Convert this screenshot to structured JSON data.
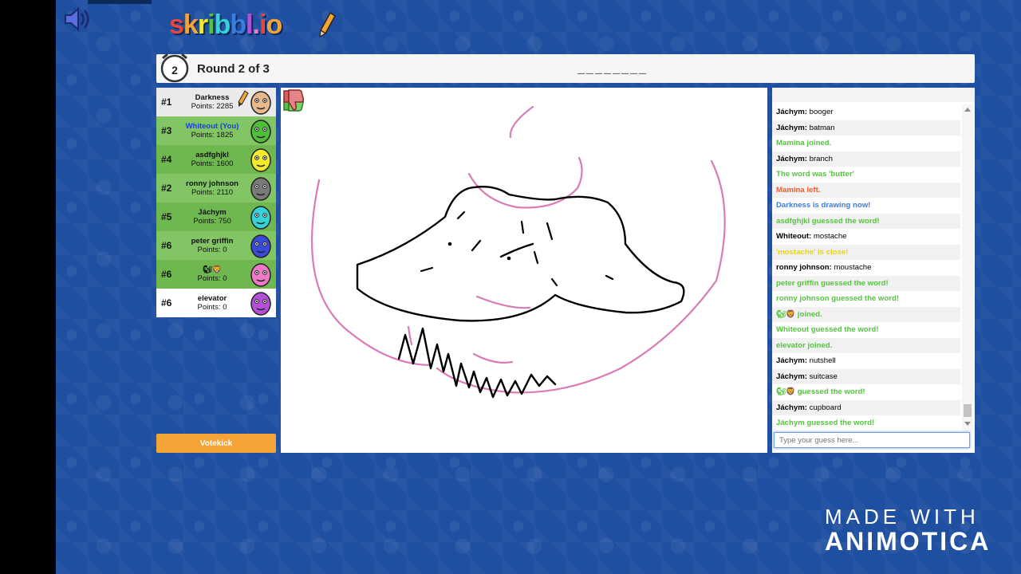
{
  "logo": {
    "text": "skribbl.io"
  },
  "header": {
    "round_text": "Round 2 of 3",
    "timer_value": "2",
    "word_hint": "________"
  },
  "players": [
    {
      "rank": "#1",
      "name": "Darkness",
      "points": "Points: 2285",
      "state": "odd",
      "drawing": true,
      "avatar_color": "#e8b98a"
    },
    {
      "rank": "#3",
      "name": "Whiteout (You)",
      "points": "Points: 1825",
      "state": "guessed",
      "you": true,
      "avatar_color": "#4fbe3a"
    },
    {
      "rank": "#4",
      "name": "asdfghjkl",
      "points": "Points: 1600",
      "state": "guessed alt",
      "avatar_color": "#f2ea2b"
    },
    {
      "rank": "#2",
      "name": "ronny johnson",
      "points": "Points: 2110",
      "state": "guessed",
      "avatar_color": "#7a7a7a"
    },
    {
      "rank": "#5",
      "name": "Jáchym",
      "points": "Points: 750",
      "state": "guessed alt",
      "avatar_color": "#35d2d8"
    },
    {
      "rank": "#6",
      "name": "peter griffin",
      "points": "Points: 0",
      "state": "guessed",
      "avatar_color": "#3a4ad8"
    },
    {
      "rank": "#6",
      "name": "🐿🦁",
      "points": "Points: 0",
      "state": "guessed alt",
      "avatar_color": "#f078c8"
    },
    {
      "rank": "#6",
      "name": "elevator",
      "points": "Points: 0",
      "state": "even",
      "avatar_color": "#b44fd8"
    }
  ],
  "votekick_label": "Votekick",
  "chat": {
    "messages": [
      {
        "who": "Jáchym:",
        "text": " booger",
        "kind": "normal"
      },
      {
        "who": "Jáchym:",
        "text": " batman",
        "kind": "normal"
      },
      {
        "who": "",
        "text": "Mamina joined.",
        "kind": "guess"
      },
      {
        "who": "Jáchym:",
        "text": " branch",
        "kind": "normal"
      },
      {
        "who": "",
        "text": "The word was 'butter'",
        "kind": "guess"
      },
      {
        "who": "",
        "text": "Mamina left.",
        "kind": "left"
      },
      {
        "who": "",
        "text": "Darkness is drawing now!",
        "kind": "draw"
      },
      {
        "who": "",
        "text": "asdfghjkl guessed the word!",
        "kind": "guess"
      },
      {
        "who": "Whiteout:",
        "text": " mostache",
        "kind": "normal"
      },
      {
        "who": "",
        "text": "'mostache' is close!",
        "kind": "close"
      },
      {
        "who": "ronny johnson:",
        "text": " moustache",
        "kind": "normal"
      },
      {
        "who": "",
        "text": "peter griffin guessed the word!",
        "kind": "guess"
      },
      {
        "who": "",
        "text": "ronny johnson guessed the word!",
        "kind": "guess"
      },
      {
        "who": "",
        "text": "🐿🦁 joined.",
        "kind": "guess"
      },
      {
        "who": "",
        "text": "Whiteout guessed the word!",
        "kind": "guess"
      },
      {
        "who": "",
        "text": "elevator joined.",
        "kind": "guess"
      },
      {
        "who": "Jáchym:",
        "text": " nutshell",
        "kind": "normal"
      },
      {
        "who": "Jáchym:",
        "text": " suitcase",
        "kind": "normal"
      },
      {
        "who": "",
        "text": "🐿🦁 guessed the word!",
        "kind": "guess"
      },
      {
        "who": "Jáchym:",
        "text": " cupboard",
        "kind": "normal"
      },
      {
        "who": "",
        "text": "Jáchym guessed the word!",
        "kind": "guess"
      }
    ],
    "input_placeholder": "Type your guess here..."
  },
  "watermark": {
    "line1": "MADE WITH",
    "line2": "ANIMOTICA"
  },
  "colors": {
    "background": "#1f4fa0",
    "guessed": "#82c564",
    "chat_guess": "#55c43f",
    "votekick": "#f4a437",
    "stroke_pink": "#d97bb5"
  }
}
